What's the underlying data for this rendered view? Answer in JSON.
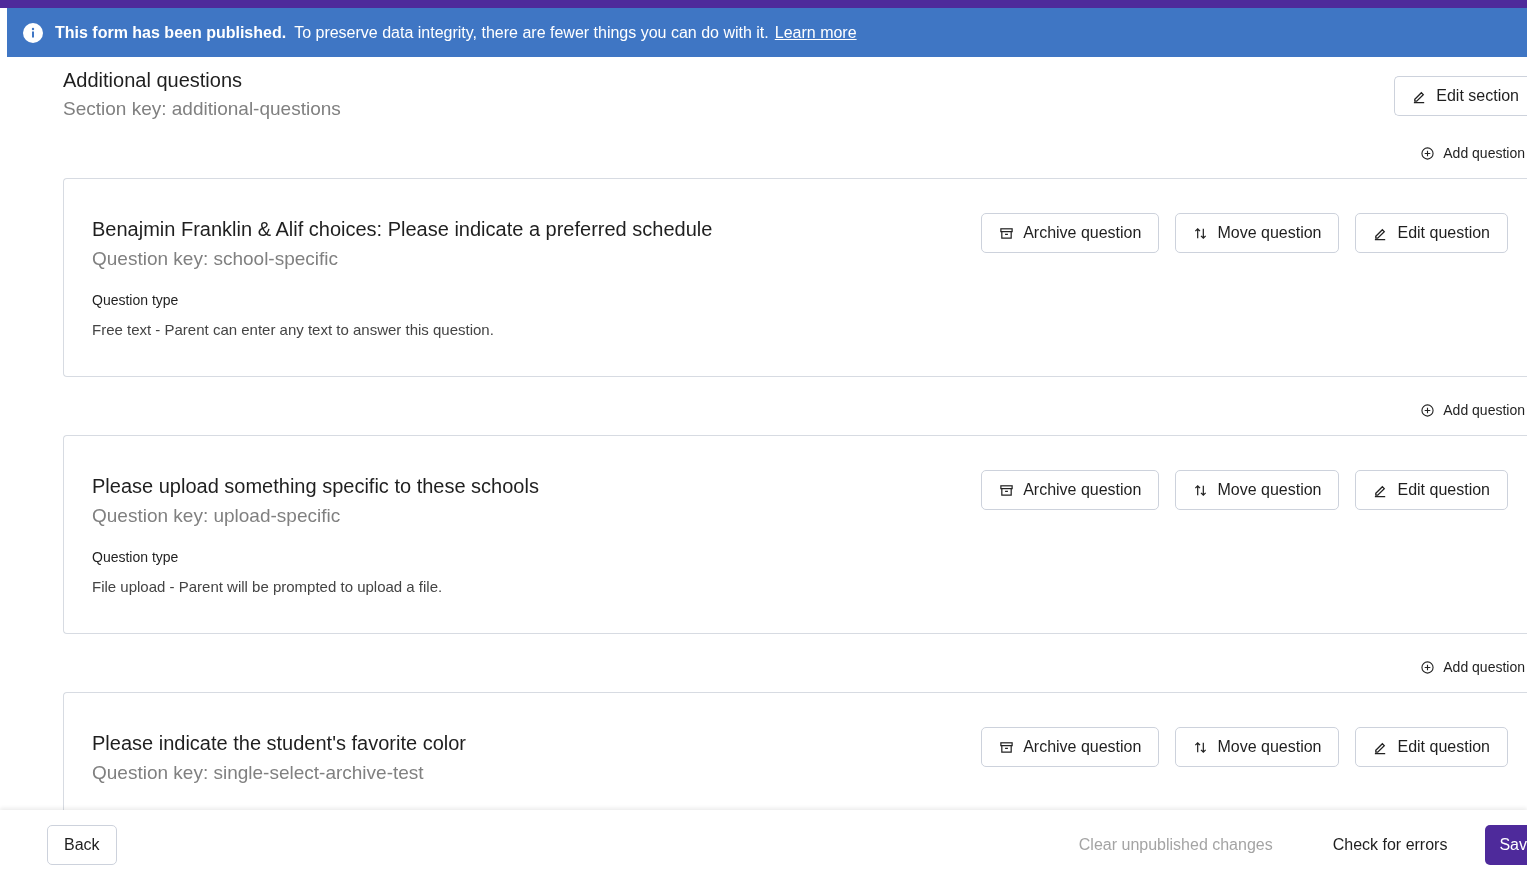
{
  "banner": {
    "title": "This form has been published.",
    "message": "To preserve data integrity, there are fewer things you can do with it.",
    "link": "Learn more"
  },
  "section": {
    "title": "Additional questions",
    "key": "Section key: additional-questions",
    "edit_button": "Edit section"
  },
  "questions": [
    {
      "add_question_label": "Add question",
      "title": "Benajmin Franklin & Alif choices: Please indicate a preferred schedule",
      "key": "Question key: school-specific",
      "type_label": "Question type",
      "type_text": "Free text - Parent can enter any text to answer this question.",
      "buttons": [
        "Archive question",
        "Move question",
        "Edit question"
      ]
    },
    {
      "add_question_label": "Add question",
      "title": "Please upload something specific to these schools",
      "key": "Question key: upload-specific",
      "type_label": "Question type",
      "type_text": "File upload - Parent will be prompted to upload a file.",
      "buttons": [
        "Archive question",
        "Move question",
        "Edit question"
      ]
    },
    {
      "add_question_label": "Add question",
      "title": "Please indicate the student's favorite color",
      "key": "Question key: single-select-archive-test",
      "buttons": [
        "Archive question",
        "Move question",
        "Edit question"
      ]
    }
  ],
  "footer": {
    "back": "Back",
    "clear": "Clear unpublished changes",
    "clear_disabled": true,
    "check": "Check for errors",
    "save": "Sav"
  }
}
